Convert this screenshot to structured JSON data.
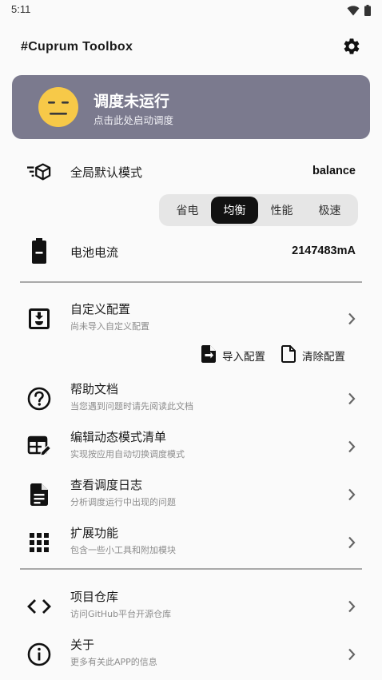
{
  "status_bar": {
    "time": "5:11",
    "icons": [
      "wifi-icon",
      "battery-icon"
    ]
  },
  "app_bar": {
    "title": "#Cuprum Toolbox",
    "settings_icon": "gear-icon"
  },
  "status_card": {
    "title": "调度未运行",
    "subtitle": "点击此处启动调度",
    "background": "#7b7a8e",
    "face_color": "#f7c948"
  },
  "global_mode": {
    "label": "全局默认模式",
    "value": "balance",
    "options": [
      "省电",
      "均衡",
      "性能",
      "极速"
    ],
    "selected": "均衡"
  },
  "battery": {
    "label": "电池电流",
    "value": "2147483mA"
  },
  "custom_config": {
    "title": "自定义配置",
    "subtitle": "尚未导入自定义配置",
    "import_label": "导入配置",
    "clear_label": "清除配置"
  },
  "menu": [
    {
      "title": "帮助文档",
      "subtitle": "当您遇到问题时请先阅读此文档",
      "icon": "help-circle-icon"
    },
    {
      "title": "编辑动态模式清单",
      "subtitle": "实现按应用自动切换调度模式",
      "icon": "edit-table-icon"
    },
    {
      "title": "查看调度日志",
      "subtitle": "分析调度运行中出现的问题",
      "icon": "document-icon"
    },
    {
      "title": "扩展功能",
      "subtitle": "包含一些小工具和附加模块",
      "icon": "grid-icon"
    }
  ],
  "footer_menu": [
    {
      "title": "项目仓库",
      "subtitle": "访问GitHub平台开源仓库",
      "icon": "code-icon"
    },
    {
      "title": "关于",
      "subtitle": "更多有关此APP的信息",
      "icon": "info-icon"
    }
  ]
}
